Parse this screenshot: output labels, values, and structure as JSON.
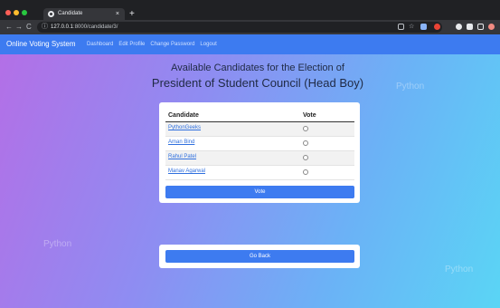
{
  "browser": {
    "tab_title": "Candidate",
    "tab_close": "×",
    "new_tab": "+",
    "back": "←",
    "forward": "→",
    "reload": "C",
    "url_host": "127.0.0.1",
    "url_rest": ":8000/candidate/3/"
  },
  "navbar": {
    "brand": "Online Voting System",
    "links": [
      "Dashboard",
      "Edit Profile",
      "Change Password",
      "Logout"
    ]
  },
  "heading": {
    "line1": "Available Candidates for the Election of",
    "line2": "President of Student Council (Head Boy)"
  },
  "table": {
    "headers": [
      "Candidate",
      "Vote"
    ],
    "rows": [
      {
        "name": "PythonGeeks"
      },
      {
        "name": "Aman Bind"
      },
      {
        "name": "Rahul Patel"
      },
      {
        "name": "Manav Agarwal"
      }
    ]
  },
  "buttons": {
    "vote": "Vote",
    "go_back": "Go Back"
  },
  "watermark": "Python"
}
